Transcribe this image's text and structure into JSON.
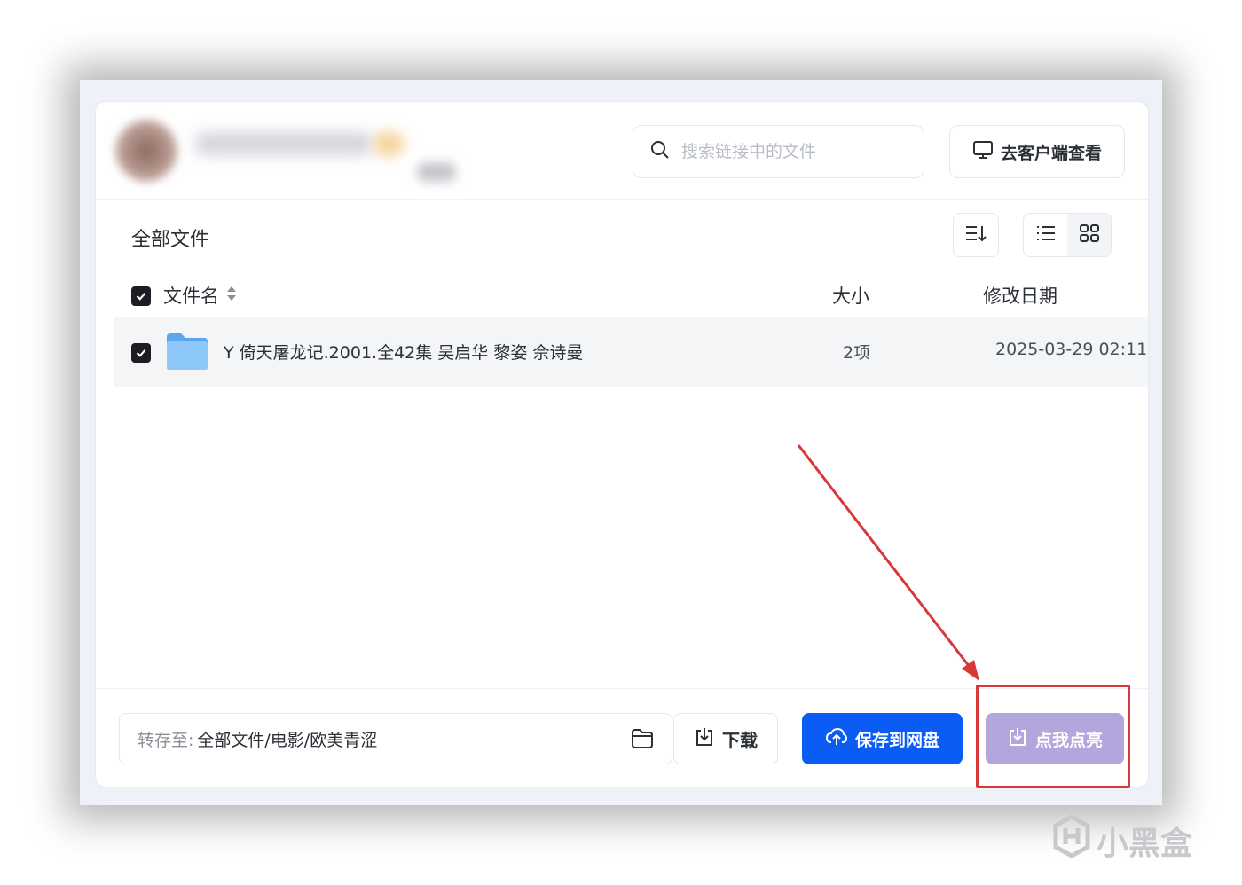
{
  "header": {
    "search_placeholder": "搜索链接中的文件",
    "client_button_label": "去客户端查看"
  },
  "toolbar": {
    "title": "全部文件"
  },
  "columns": {
    "name": "文件名",
    "size": "大小",
    "date": "修改日期"
  },
  "files": [
    {
      "name": "Y 倚天屠龙记.2001.全42集 吴启华 黎姿 佘诗曼",
      "size": "2项",
      "date": "2025-03-29 02:11",
      "checked": true
    }
  ],
  "footer": {
    "dest_label": "转存至:",
    "dest_path": "全部文件/电影/欧美青涩",
    "download_label": "下载",
    "save_label": "保存到网盘",
    "light_label": "点我点亮"
  },
  "watermark": {
    "text": "小黑盒"
  },
  "colors": {
    "primary": "#0a5cf5",
    "light_button": "#b3a6dc",
    "annotation": "#d9383b"
  }
}
